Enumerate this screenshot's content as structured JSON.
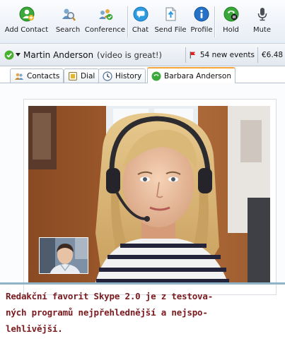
{
  "toolbar": {
    "buttons": [
      {
        "label": "Add Contact",
        "icon": "add-contact-icon"
      },
      {
        "label": "Search",
        "icon": "search-icon"
      },
      {
        "label": "Conference",
        "icon": "conference-icon"
      },
      {
        "label": "Chat",
        "icon": "chat-icon"
      },
      {
        "label": "Send File",
        "icon": "send-file-icon"
      },
      {
        "label": "Profile",
        "icon": "profile-icon"
      },
      {
        "label": "Hold",
        "icon": "hold-icon"
      },
      {
        "label": "Mute",
        "icon": "mute-icon"
      }
    ]
  },
  "status": {
    "user_name": "Martin Anderson",
    "mood": "(video is great!)",
    "events": "54 new events",
    "credit": "€6.48",
    "status_color": "#49b030"
  },
  "tabs": [
    {
      "label": "Contacts",
      "icon": "contacts-icon"
    },
    {
      "label": "Dial",
      "icon": "dial-pad-icon"
    },
    {
      "label": "History",
      "icon": "history-icon"
    },
    {
      "label": "Barbara Anderson",
      "icon": "call-icon",
      "active": true
    }
  ],
  "caption": {
    "lines": [
      "Redakční favorit Skype 2.0 je z testova-",
      "ných programů nejpřehlednější a nejspo-",
      "lehlivější."
    ],
    "color": "#7a1a1f"
  },
  "colors": {
    "accent": "#1a8fd6",
    "active_tab_border": "#f6a33a",
    "caption_rule": "#8fb3c9"
  }
}
